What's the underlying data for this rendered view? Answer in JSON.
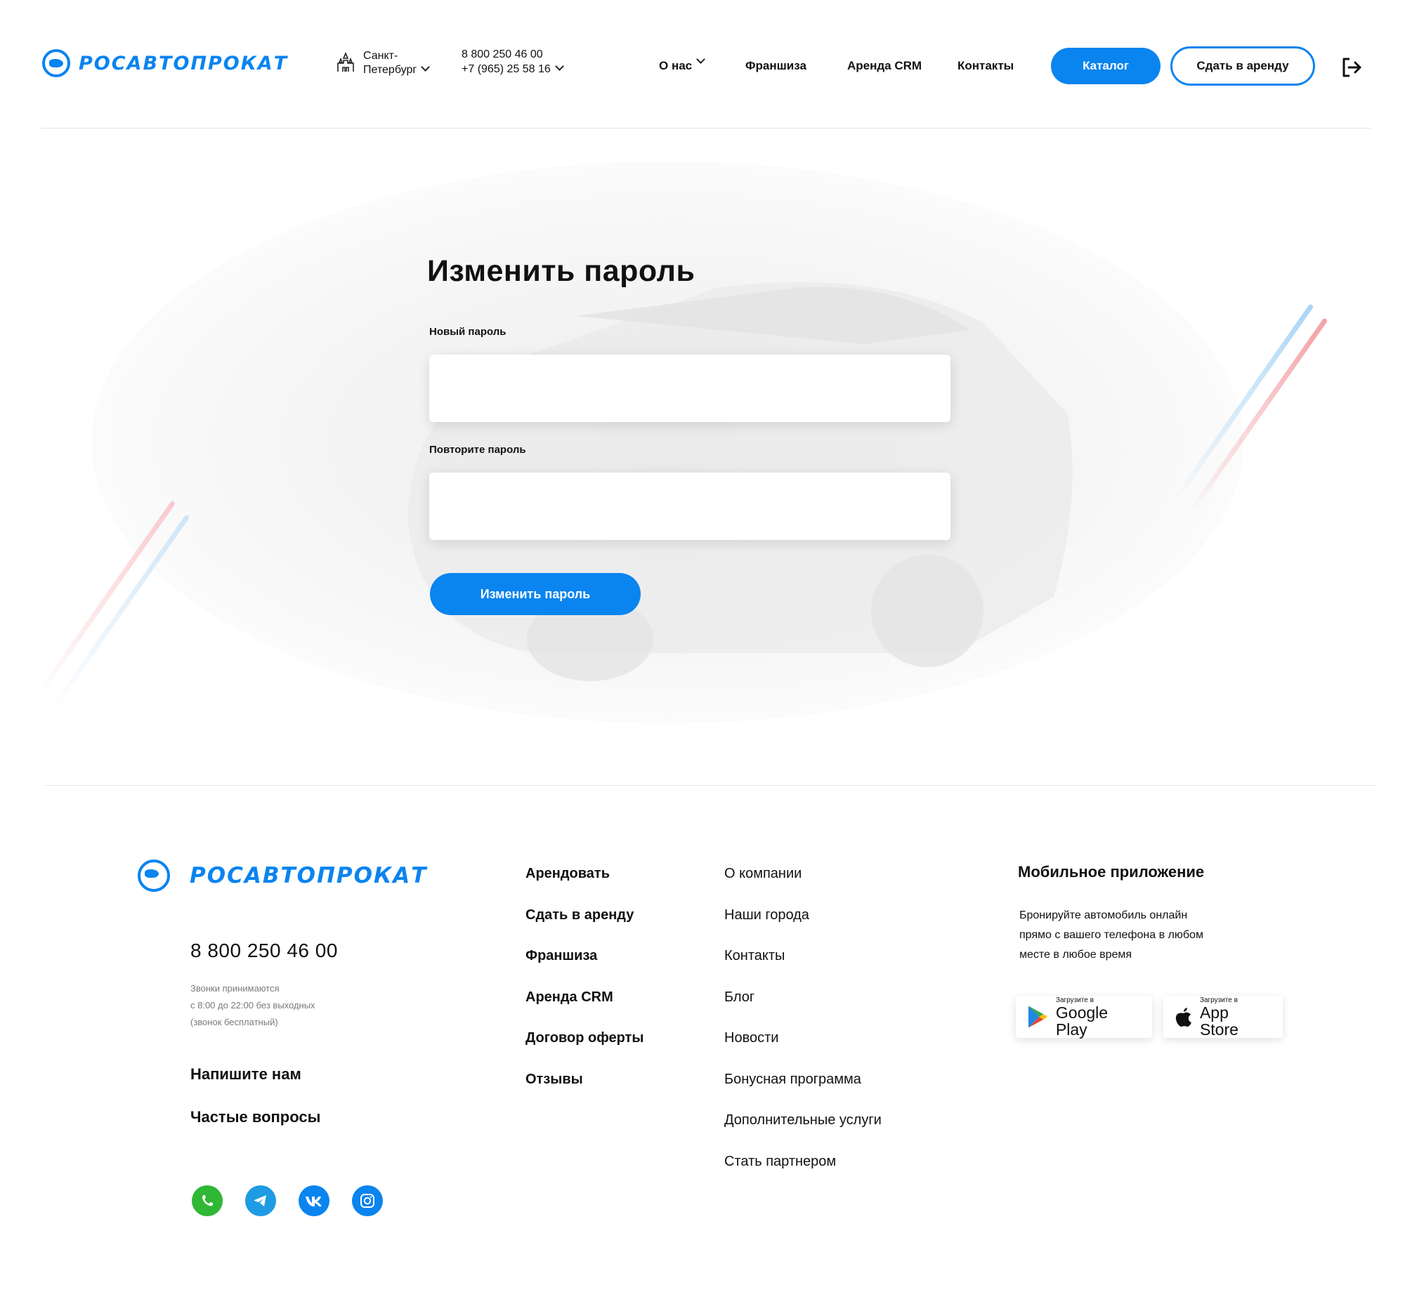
{
  "header": {
    "logo_text": "РОСАВТОПРОКАТ",
    "city_line1": "Санкт-",
    "city_line2": "Петербург",
    "phone1": "8 800 250 46 00",
    "phone2": "+7 (965) 25 58 16",
    "nav": [
      "О нас",
      "Франшиза",
      "Аренда CRM",
      "Контакты"
    ],
    "catalog_label": "Каталог",
    "rent_out_label": "Сдать в аренду"
  },
  "form": {
    "title": "Изменить пароль",
    "new_password_label": "Новый пароль",
    "new_password_value": "",
    "repeat_password_label": "Повторите пароль",
    "repeat_password_value": "",
    "submit_label": "Изменить пароль"
  },
  "footer": {
    "logo_text": "РОСАВТОПРОКАТ",
    "phone": "8 800 250 46 00",
    "note_lines": [
      "Звонки принимаются",
      "с 8:00 до 22:00 без выходных",
      "(звонок бесплатный)"
    ],
    "write_us": "Напишите нам",
    "faq": "Частые вопросы",
    "col1": [
      "Арендовать",
      "Сдать в аренду",
      "Франшиза",
      "Аренда CRM",
      "Договор оферты",
      "Отзывы"
    ],
    "col2": [
      "О компании",
      "Наши города",
      "Контакты",
      "Блог",
      "Новости",
      "Бонусная программа",
      "Дополнительные услуги",
      "Стать партнером"
    ],
    "app_title": "Мобильное приложение",
    "app_text_lines": [
      "Бронируйте автомобиль онлайн",
      "прямо с вашего телефона в любом",
      "месте в любое время"
    ],
    "google_small": "Загрузите в",
    "google_big": "Google Play",
    "apple_small": "Загрузите в",
    "apple_big": "App Store",
    "socials": [
      "whatsapp-icon",
      "telegram-icon",
      "vk-icon",
      "instagram-icon"
    ]
  },
  "colors": {
    "accent": "#0a84ef",
    "whatsapp": "#2fb735",
    "telegram": "#1e9be3",
    "stripe_red": "#f3a0a5",
    "stripe_blue": "#a8d4f5"
  }
}
